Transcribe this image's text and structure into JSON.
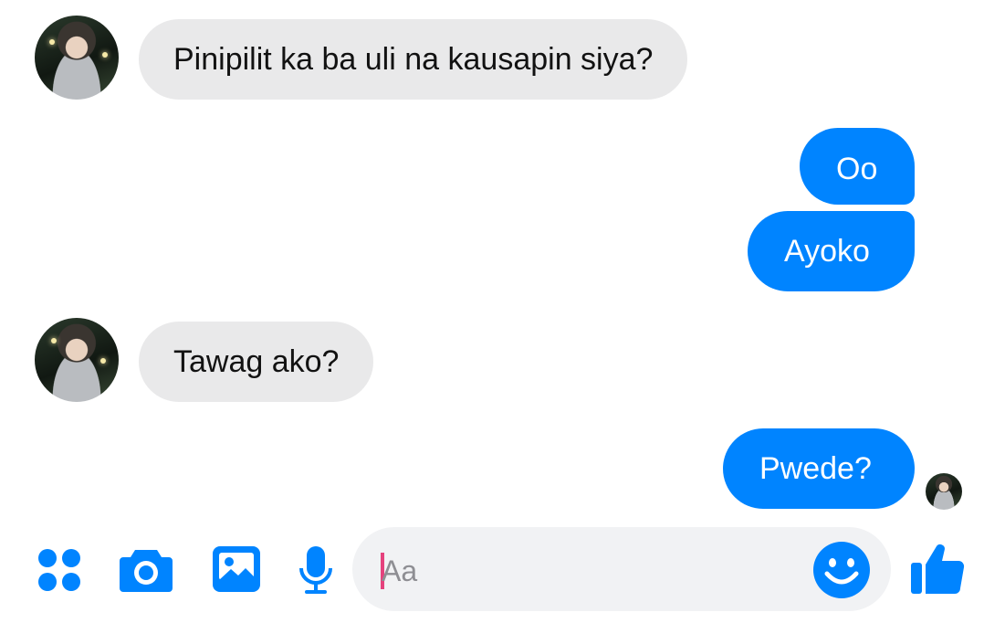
{
  "conversation": {
    "messages": [
      {
        "sender": "contact",
        "text": "Pinipilit ka ba uli na kausapin siya?"
      },
      {
        "sender": "me",
        "text": "Oo"
      },
      {
        "sender": "me",
        "text": "Ayoko"
      },
      {
        "sender": "contact",
        "text": "Tawag ako?"
      },
      {
        "sender": "me",
        "text": "Pwede?"
      }
    ]
  },
  "composer": {
    "placeholder": "Aa",
    "icons": [
      "grid-menu-icon",
      "camera-icon",
      "gallery-icon",
      "microphone-icon",
      "emoji-icon",
      "thumbs-up-icon"
    ]
  },
  "colors": {
    "outgoing_bubble": "#0084ff",
    "incoming_bubble": "#e9e9ea",
    "accent": "#0084ff",
    "caret": "#e5427d"
  }
}
